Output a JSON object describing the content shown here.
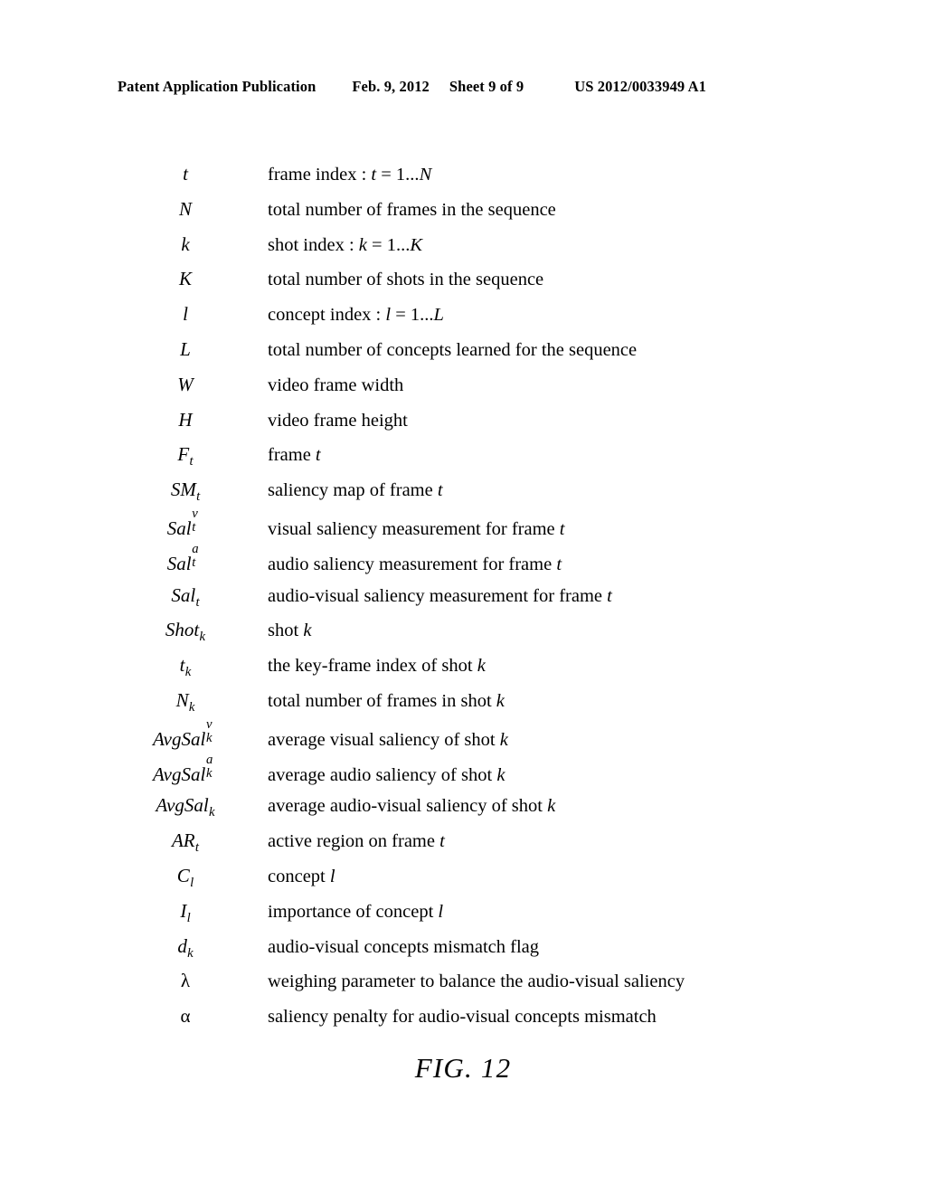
{
  "header": {
    "publication": "Patent Application Publication",
    "date": "Feb. 9, 2012",
    "sheet": "Sheet 9 of 9",
    "doc_number": "US 2012/0033949 A1"
  },
  "figure": {
    "caption": "FIG. 12"
  },
  "symbol_table": {
    "rows": [
      {
        "symbol": "t",
        "sub": "",
        "sup": "",
        "description": "frame index : t = 1...N"
      },
      {
        "symbol": "N",
        "sub": "",
        "sup": "",
        "description": "total number of frames in the sequence"
      },
      {
        "symbol": "k",
        "sub": "",
        "sup": "",
        "description": "shot index : k = 1...K"
      },
      {
        "symbol": "K",
        "sub": "",
        "sup": "",
        "description": "total number of shots in the sequence"
      },
      {
        "symbol": "l",
        "sub": "",
        "sup": "",
        "description": "concept index : l = 1...L"
      },
      {
        "symbol": "L",
        "sub": "",
        "sup": "",
        "description": "total number of concepts learned for the sequence"
      },
      {
        "symbol": "W",
        "sub": "",
        "sup": "",
        "description": "video frame width"
      },
      {
        "symbol": "H",
        "sub": "",
        "sup": "",
        "description": "video frame height"
      },
      {
        "symbol": "F",
        "sub": "t",
        "sup": "",
        "description": "frame t"
      },
      {
        "symbol": "SM",
        "sub": "t",
        "sup": "",
        "description": "saliency map of frame t"
      },
      {
        "symbol": "Sal",
        "sub": "t",
        "sup": "v",
        "description": "visual saliency measurement for frame t"
      },
      {
        "symbol": "Sal",
        "sub": "t",
        "sup": "a",
        "description": "audio saliency measurement for frame t"
      },
      {
        "symbol": "Sal",
        "sub": "t",
        "sup": "",
        "description": "audio-visual saliency measurement for frame t"
      },
      {
        "symbol": "Shot",
        "sub": "k",
        "sup": "",
        "description": "shot k"
      },
      {
        "symbol": "t",
        "sub": "k",
        "sup": "",
        "description": "the key-frame index of shot k"
      },
      {
        "symbol": "N",
        "sub": "k",
        "sup": "",
        "description": "total number of frames in shot k"
      },
      {
        "symbol": "AvgSal",
        "sub": "k",
        "sup": "v",
        "description": "average visual saliency of shot k"
      },
      {
        "symbol": "AvgSal",
        "sub": "k",
        "sup": "a",
        "description": "average audio saliency of shot k"
      },
      {
        "symbol": "AvgSal",
        "sub": "k",
        "sup": "",
        "description": "average audio-visual saliency of shot k"
      },
      {
        "symbol": "AR",
        "sub": "t",
        "sup": "",
        "description": "active region on frame t"
      },
      {
        "symbol": "C",
        "sub": "l",
        "sup": "",
        "description": "concept l"
      },
      {
        "symbol": "I",
        "sub": "l",
        "sup": "",
        "description": "importance of concept l"
      },
      {
        "symbol": "d",
        "sub": "k",
        "sup": "",
        "description": "audio-visual concepts mismatch flag"
      },
      {
        "symbol": "λ",
        "sub": "",
        "sup": "",
        "greek": true,
        "description": "weighing parameter to balance the audio-visual saliency"
      },
      {
        "symbol": "α",
        "sub": "",
        "sup": "",
        "greek": true,
        "description": "saliency penalty for audio-visual concepts mismatch"
      }
    ]
  }
}
